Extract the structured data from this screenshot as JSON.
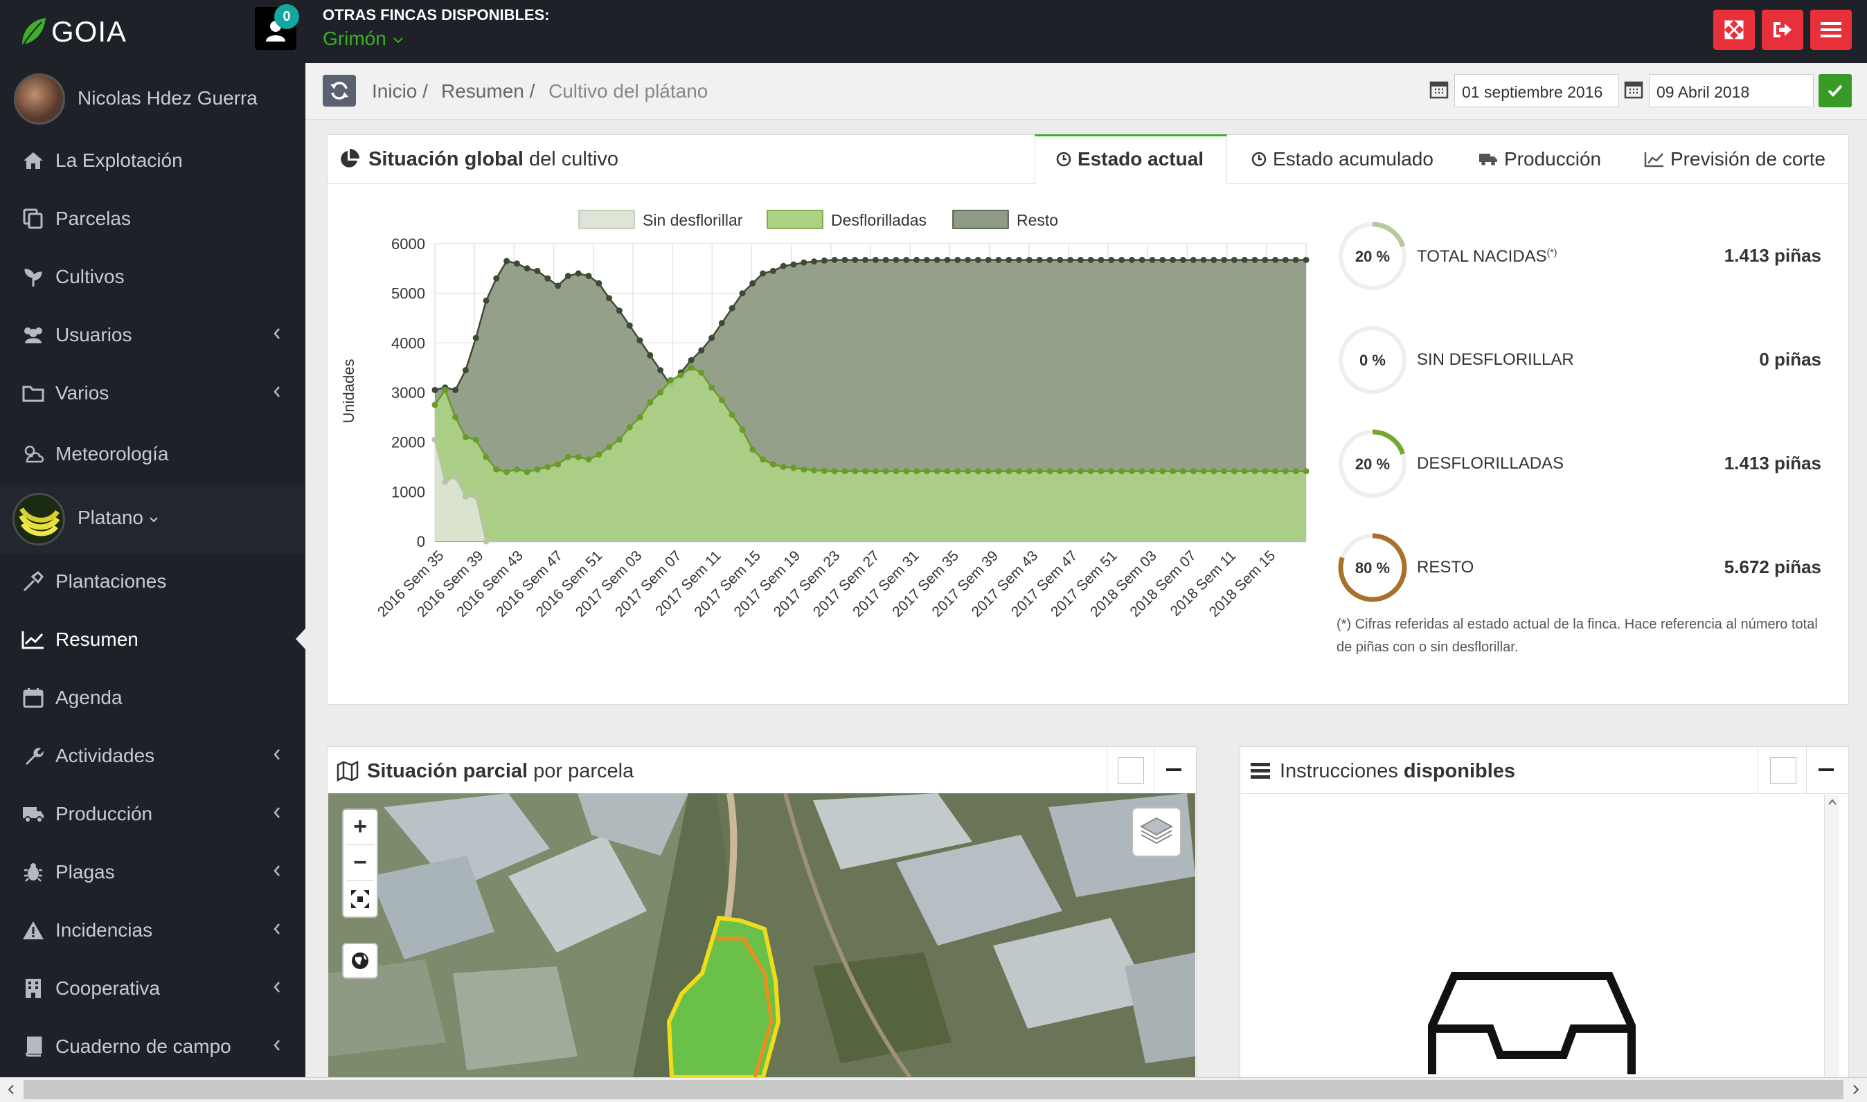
{
  "app": {
    "name": "GOIA",
    "notifications": "0"
  },
  "farm": {
    "label": "OTRAS FINCAS DISPONIBLES:",
    "selected": "Grimón"
  },
  "user": {
    "name": "Nicolas Hdez Guerra"
  },
  "sidebar": {
    "items": [
      {
        "label": "La Explotación",
        "icon": "home-icon"
      },
      {
        "label": "Parcelas",
        "icon": "parcel-icon"
      },
      {
        "label": "Cultivos",
        "icon": "plant-icon"
      },
      {
        "label": "Usuarios",
        "icon": "users-icon"
      },
      {
        "label": "Varios",
        "icon": "folder-icon"
      },
      {
        "label": "Meteorología",
        "icon": "weather-icon"
      },
      {
        "label": "Platano",
        "icon": "banana-avatar"
      },
      {
        "label": "Plantaciones",
        "icon": "plantations-icon"
      },
      {
        "label": "Resumen",
        "icon": "chart-line-icon"
      },
      {
        "label": "Agenda",
        "icon": "calendar-icon"
      },
      {
        "label": "Actividades",
        "icon": "wrench-icon"
      },
      {
        "label": "Producción",
        "icon": "truck-icon"
      },
      {
        "label": "Plagas",
        "icon": "bug-icon"
      },
      {
        "label": "Incidencias",
        "icon": "warning-icon"
      },
      {
        "label": "Cooperativa",
        "icon": "building-icon"
      },
      {
        "label": "Cuaderno de campo",
        "icon": "book-icon"
      }
    ]
  },
  "breadcrumb": {
    "items": [
      "Inicio /",
      "Resumen /",
      "Cultivo del plátano"
    ]
  },
  "dates": {
    "from": "01 septiembre 2016",
    "to": "09 Abril 2018"
  },
  "global_panel": {
    "title_bold": "Situación global",
    "title_rest": " del cultivo",
    "tabs": [
      "Estado actual",
      "Estado acumulado",
      "Producción",
      "Previsión de corte"
    ]
  },
  "stats": [
    {
      "percent": "20 %",
      "label": "TOTAL NACIDAS",
      "sup": "(*)",
      "value": "1.413 piñas",
      "fraction": 0.2,
      "color": "#b6c99a"
    },
    {
      "percent": "0 %",
      "label": "SIN DESFLORILLAR",
      "sup": "",
      "value": "0 piñas",
      "fraction": 0.0,
      "color": "#cfd9c2"
    },
    {
      "percent": "20 %",
      "label": "DESFLORILLADAS",
      "sup": "",
      "value": "1.413 piñas",
      "fraction": 0.2,
      "color": "#72a832"
    },
    {
      "percent": "80 %",
      "label": "RESTO",
      "sup": "",
      "value": "5.672 piñas",
      "fraction": 0.8,
      "color": "#a7702b"
    }
  ],
  "footnote": "(*) Cifras referidas al estado actual de la finca. Hace referencia al número total de piñas con o sin desflorillar.",
  "partial_panel": {
    "title_bold": "Situación parcial",
    "title_rest": " por parcela"
  },
  "instructions_panel": {
    "title_bold": "",
    "title_rest": "Instrucciones ",
    "title_bold2": "disponibles"
  },
  "map": {
    "zoom_in": "+",
    "zoom_out": "−"
  },
  "chart_data": {
    "type": "area",
    "ylabel": "Unidades",
    "xlabel": "",
    "ylim": [
      0,
      6000
    ],
    "yticks": [
      0,
      1000,
      2000,
      3000,
      4000,
      5000,
      6000
    ],
    "legend": [
      "Sin desflorillar",
      "Desflorilladas",
      "Resto"
    ],
    "legend_position": "top",
    "grid": true,
    "categories": [
      "2016 Sem 35",
      "2016 Sem 39",
      "2016 Sem 43",
      "2016 Sem 47",
      "2016 Sem 51",
      "2017 Sem 03",
      "2017 Sem 07",
      "2017 Sem 11",
      "2017 Sem 15",
      "2017 Sem 19",
      "2017 Sem 23",
      "2017 Sem 27",
      "2017 Sem 31",
      "2017 Sem 35",
      "2017 Sem 39",
      "2017 Sem 43",
      "2017 Sem 47",
      "2017 Sem 51",
      "2018 Sem 03",
      "2018 Sem 07",
      "2018 Sem 11",
      "2018 Sem 15"
    ],
    "series": [
      {
        "name": "Sin desflorillar",
        "color": "#dfe5d6",
        "line": "#b8c4a8",
        "values": [
          2050,
          1200,
          1300,
          900,
          900,
          0,
          0,
          0,
          0,
          0,
          0,
          0,
          0,
          0,
          0,
          0,
          0,
          0,
          0,
          0,
          0,
          0,
          0,
          0,
          0,
          0,
          0,
          0,
          0,
          0,
          0,
          0,
          0,
          0,
          0,
          0,
          0,
          0,
          0,
          0,
          0,
          0,
          0,
          0,
          0,
          0,
          0,
          0,
          0,
          0,
          0,
          0,
          0,
          0,
          0,
          0,
          0,
          0,
          0,
          0,
          0,
          0,
          0,
          0,
          0,
          0,
          0,
          0,
          0,
          0,
          0,
          0,
          0,
          0,
          0,
          0,
          0,
          0,
          0,
          0,
          0,
          0,
          0,
          0,
          0,
          0
        ]
      },
      {
        "name": "Desflorilladas",
        "color": "#acd384",
        "line": "#6a9b28",
        "values": [
          2750,
          3050,
          2500,
          2100,
          2050,
          1700,
          1450,
          1400,
          1450,
          1400,
          1450,
          1500,
          1550,
          1700,
          1700,
          1650,
          1750,
          1900,
          2050,
          2300,
          2500,
          2800,
          3000,
          3250,
          3350,
          3500,
          3400,
          3100,
          2850,
          2550,
          2250,
          1850,
          1650,
          1550,
          1500,
          1480,
          1450,
          1430,
          1420,
          1413,
          1413,
          1413,
          1413,
          1413,
          1413,
          1413,
          1413,
          1413,
          1413,
          1413,
          1413,
          1413,
          1413,
          1413,
          1413,
          1413,
          1413,
          1413,
          1413,
          1413,
          1413,
          1413,
          1413,
          1413,
          1413,
          1413,
          1413,
          1413,
          1413,
          1413,
          1413,
          1413,
          1413,
          1413,
          1413,
          1413,
          1413,
          1413,
          1413,
          1413,
          1413,
          1413,
          1413,
          1413,
          1413,
          1413
        ]
      },
      {
        "name": "Resto",
        "color": "#8f9b84",
        "line": "#3e4a34",
        "values": [
          3050,
          3100,
          3050,
          3450,
          4100,
          4850,
          5300,
          5650,
          5600,
          5500,
          5450,
          5300,
          5150,
          5350,
          5400,
          5350,
          5200,
          4900,
          4650,
          4350,
          4050,
          3750,
          3450,
          3150,
          3400,
          3650,
          3850,
          4100,
          4400,
          4700,
          5000,
          5200,
          5400,
          5450,
          5550,
          5580,
          5620,
          5640,
          5660,
          5672,
          5672,
          5672,
          5672,
          5672,
          5672,
          5672,
          5672,
          5672,
          5672,
          5672,
          5672,
          5672,
          5672,
          5672,
          5672,
          5672,
          5672,
          5672,
          5672,
          5672,
          5672,
          5672,
          5672,
          5672,
          5672,
          5672,
          5672,
          5672,
          5672,
          5672,
          5672,
          5672,
          5672,
          5672,
          5672,
          5672,
          5672,
          5672,
          5672,
          5672,
          5672,
          5672,
          5672,
          5672,
          5672,
          5672
        ]
      }
    ]
  }
}
